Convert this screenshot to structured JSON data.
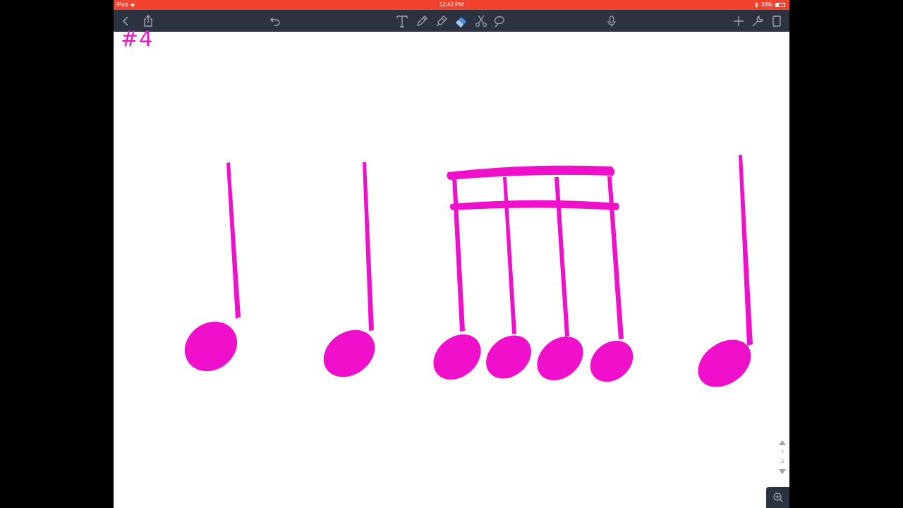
{
  "status_bar": {
    "device": "iPad",
    "time": "12:42 PM",
    "battery_text": "33%",
    "battery_level": 0.33
  },
  "toolbar": {
    "left_icons": [
      "back-icon",
      "share-icon"
    ],
    "center_icons": [
      "undo-icon",
      "text-tool-icon",
      "pen-tool-icon",
      "highlighter-tool-icon",
      "eraser-tool-icon",
      "scissors-tool-icon",
      "lasso-tool-icon"
    ],
    "right_icons": [
      "microphone-icon",
      "add-icon",
      "wrench-icon",
      "pages-icon"
    ],
    "active_tool": "eraser"
  },
  "document": {
    "page_label": "#4",
    "ink_color": "#f00fca"
  },
  "page_navigator": {
    "current": "3",
    "total": "11"
  },
  "colors": {
    "status_bar": "#f2432e",
    "toolbar": "#2b3240",
    "ink": "#f00fca"
  }
}
